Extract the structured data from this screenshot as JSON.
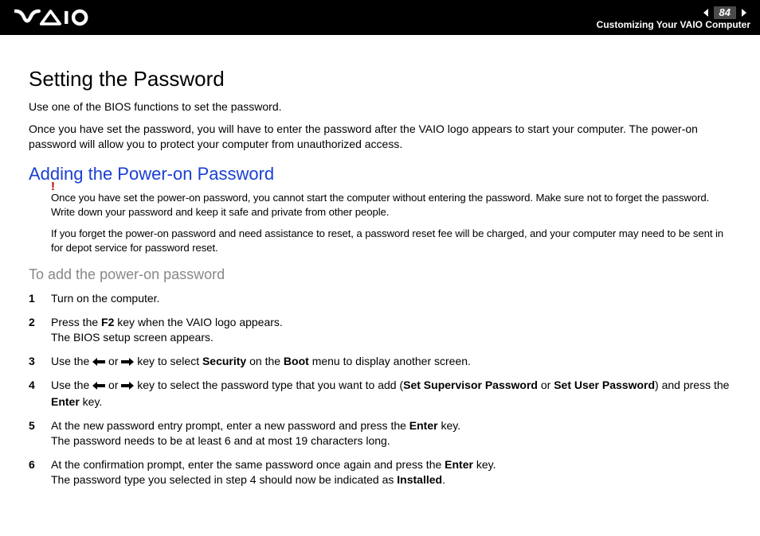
{
  "header": {
    "page_number": "84",
    "section": "Customizing Your VAIO Computer"
  },
  "main": {
    "title": "Setting the Password",
    "intro1": "Use one of the BIOS functions to set the password.",
    "intro2": "Once you have set the password, you will have to enter the password after the VAIO logo appears to start your computer. The power-on password will allow you to protect your computer from unauthorized access.",
    "sub_title": "Adding the Power-on Password",
    "warn1": "Once you have set the power-on password, you cannot start the computer without entering the password. Make sure not to forget the password. Write down your password and keep it safe and private from other people.",
    "warn2": "If you forget the power-on password and need assistance to reset, a password reset fee will be charged, and your computer may need to be sent in for depot service for password reset.",
    "procedure_title": "To add the power-on password",
    "steps": {
      "s1": {
        "n": "1",
        "a": "Turn on the computer."
      },
      "s2": {
        "n": "2",
        "a": "Press the ",
        "b": "F2",
        "c": " key when the VAIO logo appears.",
        "d": "The BIOS setup screen appears."
      },
      "s3": {
        "n": "3",
        "a": "Use the ",
        "b": " or ",
        "c": " key to select ",
        "d": "Security",
        "e": " on the ",
        "f": "Boot",
        "g": " menu to display another screen."
      },
      "s4": {
        "n": "4",
        "a": "Use the ",
        "b": " or ",
        "c": " key to select the password type that you want to add (",
        "d": "Set Supervisor Password",
        "e": " or ",
        "f": "Set User Password",
        "g": ") and press the ",
        "h": "Enter",
        "i": " key."
      },
      "s5": {
        "n": "5",
        "a": "At the new password entry prompt, enter a new password and press the ",
        "b": "Enter",
        "c": " key.",
        "d": "The password needs to be at least 6 and at most 19 characters long."
      },
      "s6": {
        "n": "6",
        "a": "At the confirmation prompt, enter the same password once again and press the ",
        "b": "Enter",
        "c": " key.",
        "d": "The password type you selected in step 4 should now be indicated as ",
        "e": "Installed",
        "f": "."
      }
    }
  }
}
